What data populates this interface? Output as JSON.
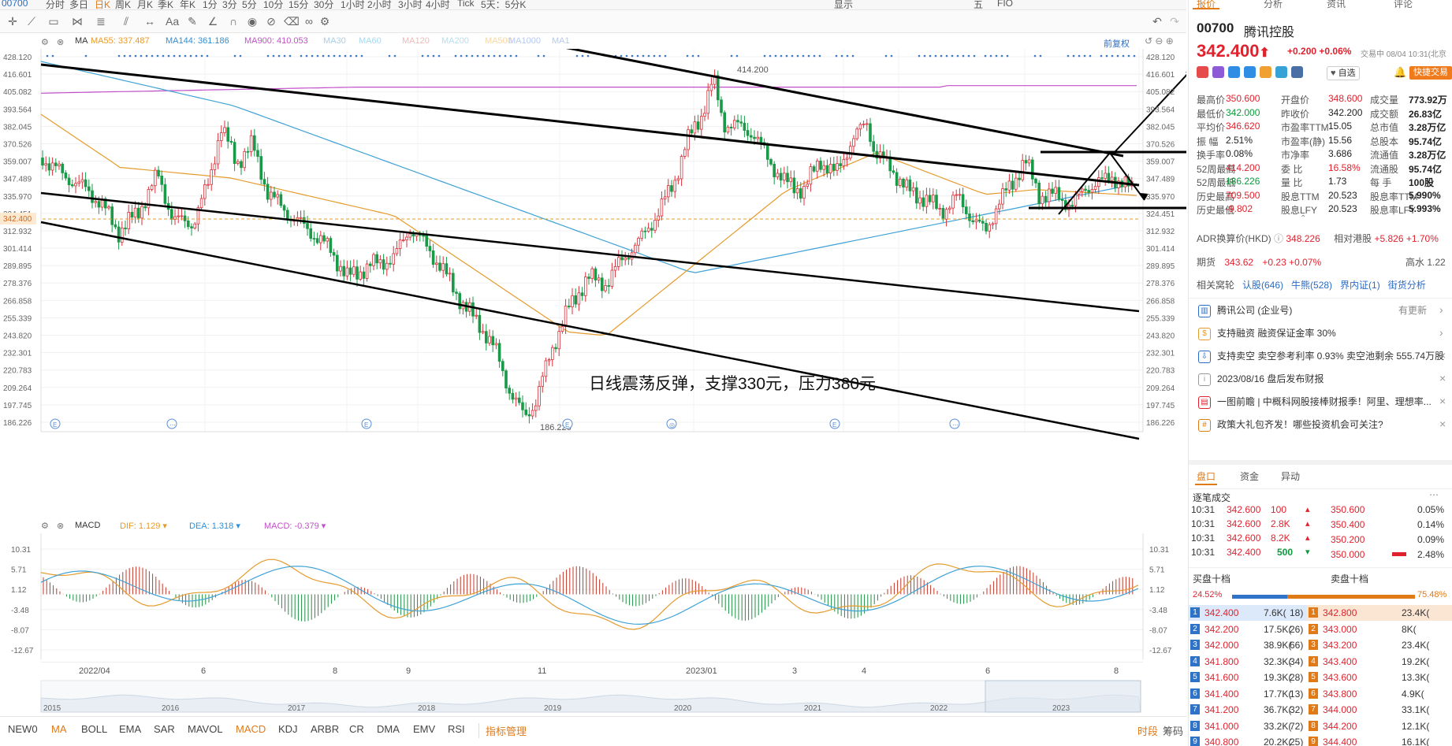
{
  "topbar": {
    "items": [
      "00700",
      "分时",
      "多日",
      "日K",
      "周K",
      "月K",
      "季K",
      "年K",
      "1分",
      "3分",
      "5分",
      "10分",
      "15分",
      "30分",
      "1小时",
      "2小时",
      "3小时",
      "4小时",
      "Tick",
      "5天：5分K"
    ],
    "right": [
      "显示",
      "五",
      "FIO"
    ]
  },
  "ma_legend": {
    "indicator": "MA",
    "items": [
      {
        "label": "MA55:",
        "value": "337.487",
        "color": "#e59b2c"
      },
      {
        "label": "MA144:",
        "value": "361.186",
        "color": "#2e8fd6"
      },
      {
        "label": "MA900:",
        "value": "410.053",
        "color": "#c24fc9"
      },
      {
        "label": "MA30",
        "value": "",
        "color": "#a9cfe8"
      },
      {
        "label": "MA60",
        "value": "",
        "color": "#a9d8ef"
      },
      {
        "label": "MA120",
        "value": "",
        "color": "#f0b9b9"
      },
      {
        "label": "MA200",
        "value": "",
        "color": "#b6dff0"
      },
      {
        "label": "MA500",
        "value": "",
        "color": "#f6d7a7"
      },
      {
        "label": "MA1000",
        "value": "",
        "color": "#b6c9ef"
      },
      {
        "label": "MA1",
        "value": "",
        "color": "#b6c9ef"
      }
    ],
    "right_label": "前复权"
  },
  "price_axis": [
    "428.120",
    "416.601",
    "405.082",
    "393.564",
    "382.045",
    "370.526",
    "359.007",
    "347.489",
    "335.970",
    "324.451",
    "312.932",
    "301.414",
    "289.895",
    "278.376",
    "266.858",
    "255.339",
    "243.820",
    "232.301",
    "220.783",
    "209.264",
    "197.745",
    "186.226"
  ],
  "current_price_tag": "342.400",
  "high_mark": "414.200",
  "low_mark": "186.226",
  "annotation": "日线震荡反弹，支撑330元，压力380元",
  "macd_legend": {
    "indicator": "MACD",
    "items": [
      {
        "label": "DIF:",
        "value": "1.129",
        "color": "#e59b2c"
      },
      {
        "label": "DEA:",
        "value": "1.318",
        "color": "#2e8fd6"
      },
      {
        "label": "MACD:",
        "value": "-0.379",
        "color": "#c24fc9"
      }
    ]
  },
  "macd_axis": [
    "10.31",
    "5.71",
    "1.12",
    "-3.48",
    "-8.07",
    "-12.67"
  ],
  "time_axis": [
    "2022/04",
    "6",
    "8",
    "9",
    "11",
    "2023/01",
    "3",
    "4",
    "6",
    "8"
  ],
  "overview_years": [
    "2015",
    "2016",
    "2017",
    "2018",
    "2019",
    "2020",
    "2021",
    "2022",
    "2023"
  ],
  "indicator_bar": {
    "items": [
      "NEW0",
      "MA",
      "BOLL",
      "EMA",
      "SAR",
      "MAVOL",
      "MACD",
      "KDJ",
      "ARBR",
      "CR",
      "DMA",
      "EMV",
      "RSI"
    ],
    "active": [
      "MA",
      "MACD"
    ],
    "manage": "指标管理",
    "right": [
      "时段",
      "筹码"
    ]
  },
  "panel": {
    "tabs": [
      "报价",
      "分析",
      "资讯",
      "评论"
    ],
    "code": "00700",
    "name": "腾讯控股",
    "price": "342.400",
    "change": "+0.200",
    "pct": "+0.06%",
    "status": "交易中 08/04 10:31(北京",
    "watch_label": "自选",
    "quick_trade": "快捷交易",
    "stats": [
      [
        "最高价",
        "350.600",
        "开盘价",
        "348.600",
        "成交量",
        "773.92万"
      ],
      [
        "最低价",
        "342.000",
        "昨收价",
        "342.200",
        "成交额",
        "26.83亿"
      ],
      [
        "平均价",
        "346.620",
        "市盈率TTM",
        "15.05",
        "总市值",
        "3.28万亿"
      ],
      [
        "振  幅",
        "2.51%",
        "市盈率(静)",
        "15.56",
        "总股本",
        "95.74亿"
      ],
      [
        "换手率",
        "0.08%",
        "市净率",
        "3.686",
        "流通值",
        "3.28万亿"
      ],
      [
        "52周最高",
        "414.200",
        "委  比",
        "16.58%",
        "流通股",
        "95.74亿"
      ],
      [
        "52周最低",
        "186.226",
        "量  比",
        "1.73",
        "每  手",
        "100股"
      ],
      [
        "历史最高",
        "709.500",
        "股息TTM",
        "20.523",
        "股息率TTM",
        "5.990%"
      ],
      [
        "历史最低",
        "-9.802",
        "股息LFY",
        "20.523",
        "股息率LFY",
        "5.993%"
      ]
    ],
    "adr_label": "ADR换算价(HKD)",
    "adr_value": "348.226",
    "adr_rel_label": "相对港股",
    "adr_rel_value": "+5.826 +1.70%",
    "futures_label": "期货",
    "futures_value": "343.62",
    "futures_change": "+0.23  +0.07%",
    "futures_right": "高水 1.22",
    "warrants": [
      "相关窝轮",
      "认股(646)",
      "牛熊(528)",
      "界内证(1)",
      "街货分析"
    ],
    "news": [
      {
        "icon": "building-icon",
        "text": "腾讯公司 (企业号)",
        "extra": "有更新"
      },
      {
        "icon": "coin-icon",
        "text": "支持融资 融资保证金率 30%",
        "extra": ""
      },
      {
        "icon": "short-icon",
        "text": "支持卖空 卖空参考利率 0.93% 卖空池剩余 555.74万股",
        "extra": ""
      },
      {
        "icon": "info-icon",
        "text": "2023/08/16  盘后发布财报",
        "extra": ""
      },
      {
        "icon": "doc-icon",
        "text": "一图前瞻 | 中概科网股接棒财报季！阿里、理想率...",
        "extra": ""
      },
      {
        "icon": "hash-icon",
        "text": "政策大礼包齐发！哪些投资机会可关注?",
        "extra": ""
      }
    ],
    "sub_tabs": [
      "盘口",
      "资金",
      "异动"
    ],
    "ticks_title": "逐笔成交",
    "ticks": [
      [
        "10:31",
        "342.600",
        "100"
      ],
      [
        "10:31",
        "342.600",
        "2.8K"
      ],
      [
        "10:31",
        "342.600",
        "8.2K"
      ],
      [
        "10:31",
        "342.400",
        "500"
      ]
    ],
    "ladder": [
      [
        "350.600",
        "0.05%"
      ],
      [
        "350.400",
        "0.14%"
      ],
      [
        "350.200",
        "0.09%"
      ],
      [
        "350.000",
        "2.48%"
      ]
    ],
    "bid_title": "买盘十档",
    "ask_title": "卖盘十档",
    "bid_pct": "24.52%",
    "ask_pct": "75.48%",
    "bids": [
      [
        "1",
        "342.400",
        "7.6K(",
        "18)"
      ],
      [
        "2",
        "342.200",
        "17.5K(",
        "26)"
      ],
      [
        "3",
        "342.000",
        "38.9K(",
        "66)"
      ],
      [
        "4",
        "341.800",
        "32.3K(",
        "34)"
      ],
      [
        "5",
        "341.600",
        "19.3K(",
        "28)"
      ],
      [
        "6",
        "341.400",
        "17.7K(",
        "13)"
      ],
      [
        "7",
        "341.200",
        "36.7K(",
        "32)"
      ],
      [
        "8",
        "341.000",
        "33.2K(",
        "72)"
      ],
      [
        "9",
        "340.800",
        "20.2K(",
        "25)"
      ]
    ],
    "asks": [
      [
        "1",
        "342.800",
        "23.4K("
      ],
      [
        "2",
        "343.000",
        "8K("
      ],
      [
        "3",
        "343.200",
        "23.4K("
      ],
      [
        "4",
        "343.400",
        "19.2K("
      ],
      [
        "5",
        "343.600",
        "13.3K("
      ],
      [
        "6",
        "343.800",
        "4.9K("
      ],
      [
        "7",
        "344.000",
        "33.1K("
      ],
      [
        "8",
        "344.200",
        "12.1K("
      ],
      [
        "9",
        "344.400",
        "16.1K("
      ]
    ]
  }
}
